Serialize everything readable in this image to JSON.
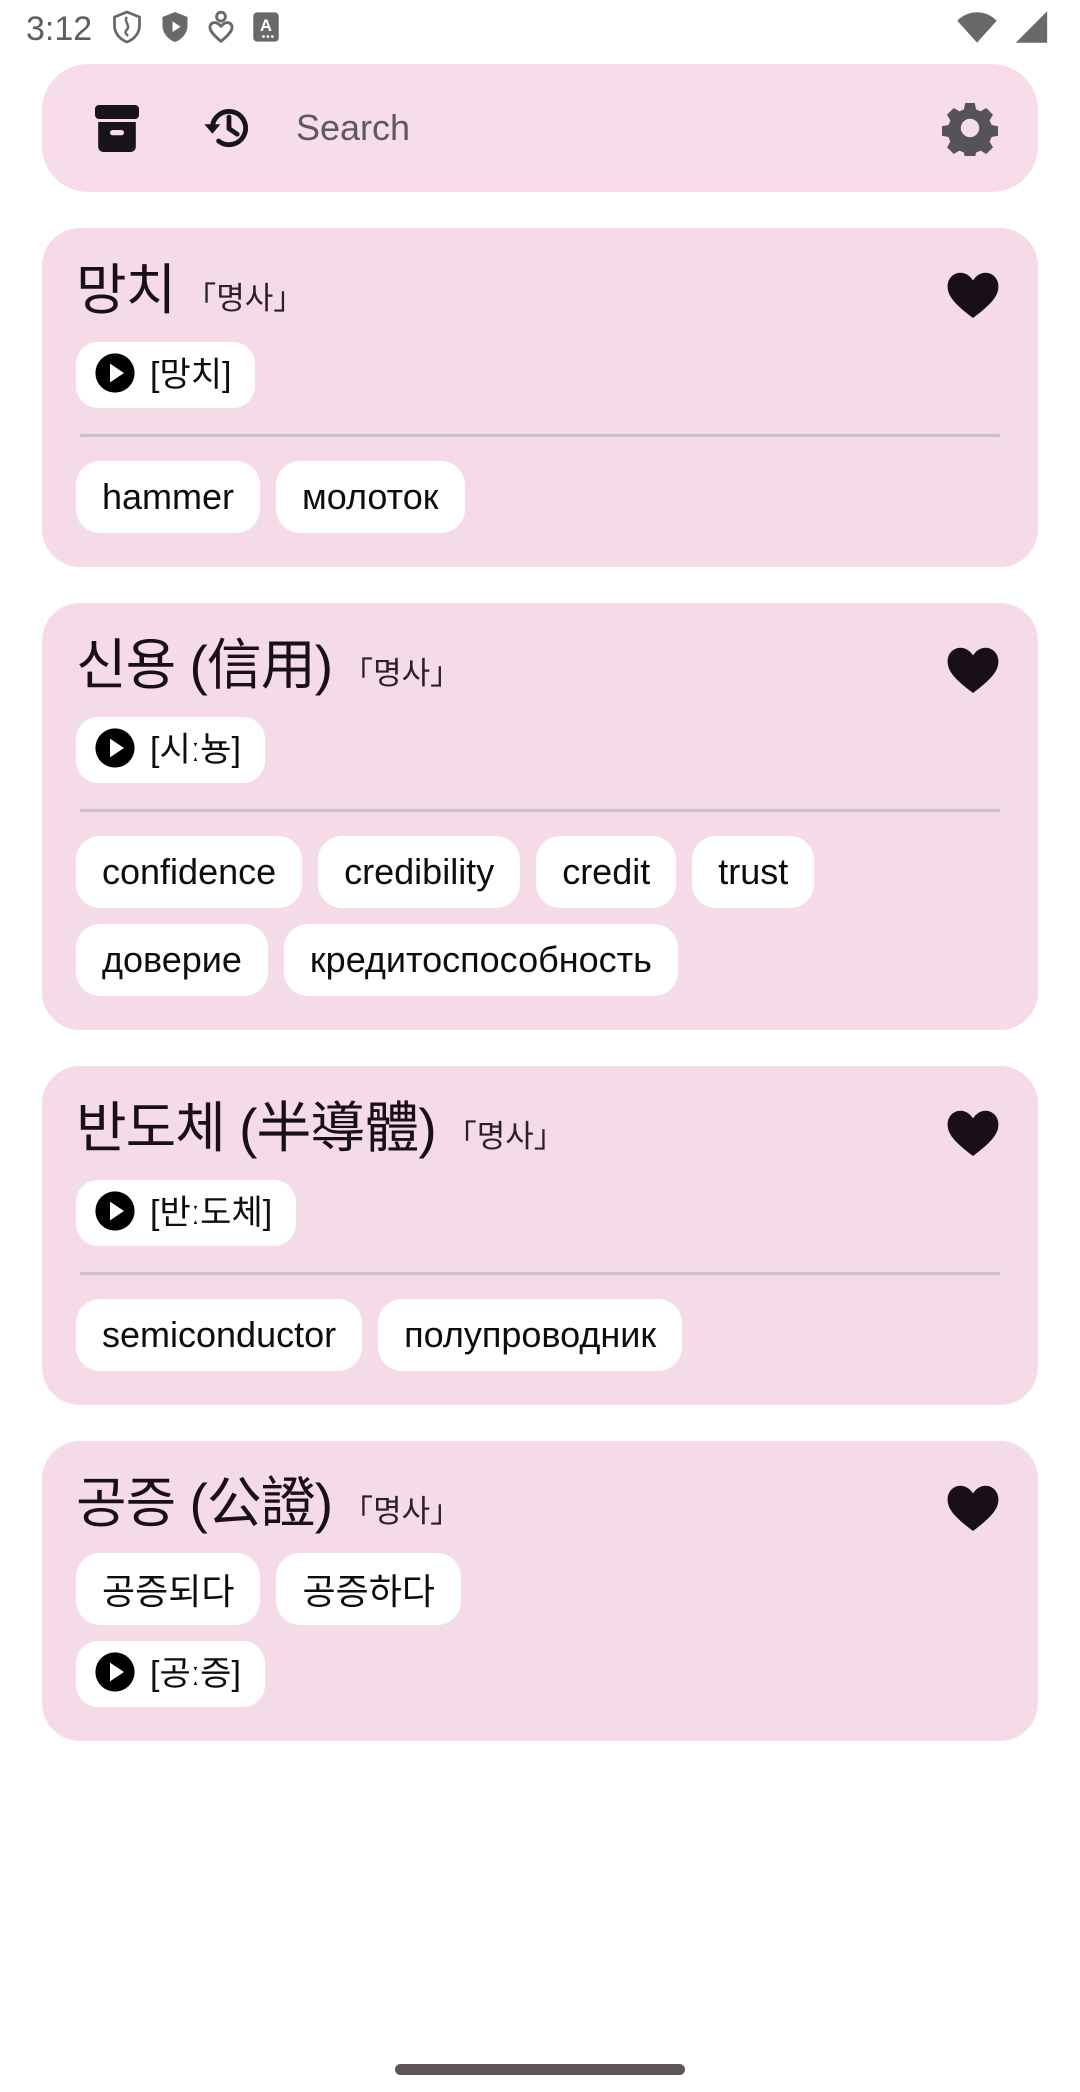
{
  "status_bar": {
    "time": "3:12",
    "left_icons": [
      "shield-outline-icon",
      "shield-play-icon",
      "person-heart-icon",
      "a-badge-icon"
    ],
    "right_icons": [
      "wifi-icon",
      "cellular-signal-icon"
    ],
    "icon_color": "#6b686c"
  },
  "search": {
    "placeholder": "Search",
    "archive_icon": "archive-box-icon",
    "history_icon": "history-clock-icon",
    "settings_icon": "gear-icon",
    "background": "#f7dde9"
  },
  "theme": {
    "page_background": "#ffffff",
    "card_background": "#f5dbe8",
    "chip_background": "#ffffff",
    "text_color": "#191017",
    "divider_color": "#c9c2c7",
    "favorite_icon_color": "#191017"
  },
  "cards": [
    {
      "term": "망치",
      "pos": "「명사」",
      "favorited": true,
      "favorite_icon": "heart-filled-icon",
      "play_icon": "play-circle-icon",
      "pronunciation": "[망치]",
      "has_divider": true,
      "top_chips": [],
      "translations": [
        "hammer",
        "молоток"
      ]
    },
    {
      "term": "신용 (信用)",
      "pos": "「명사」",
      "favorited": true,
      "favorite_icon": "heart-filled-icon",
      "play_icon": "play-circle-icon",
      "pronunciation": "[시ː뇽]",
      "has_divider": true,
      "top_chips": [],
      "translations": [
        "confidence",
        "credibility",
        "credit",
        "trust",
        "доверие",
        "кредитоспособность"
      ]
    },
    {
      "term": "반도체 (半導體)",
      "pos": "「명사」",
      "favorited": true,
      "favorite_icon": "heart-filled-icon",
      "play_icon": "play-circle-icon",
      "pronunciation": "[반ː도체]",
      "has_divider": true,
      "top_chips": [],
      "translations": [
        "semiconductor",
        "полупроводник"
      ]
    },
    {
      "term": "공증 (公證)",
      "pos": "「명사」",
      "favorited": true,
      "favorite_icon": "heart-filled-icon",
      "play_icon": "play-circle-icon",
      "pronunciation": "[공ː증]",
      "has_divider": false,
      "top_chips": [
        "공증되다",
        "공증하다"
      ],
      "translations": []
    }
  ],
  "gesture_bar": {
    "handle": "home-gesture-handle"
  }
}
